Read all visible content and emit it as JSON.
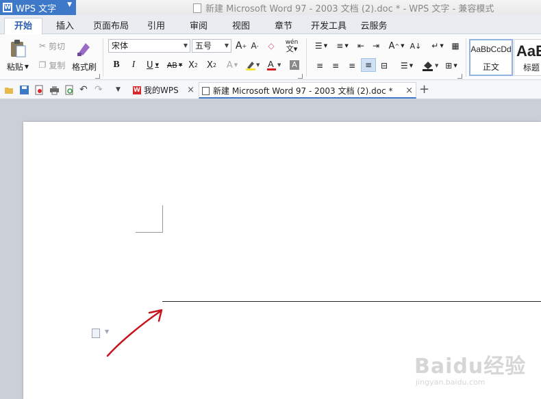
{
  "app": {
    "name": "WPS 文字",
    "window_title": "新建 Microsoft Word 97 - 2003 文档 (2).doc * - WPS 文字 - 兼容模式"
  },
  "tabs": [
    "开始",
    "插入",
    "页面布局",
    "引用",
    "审阅",
    "视图",
    "章节",
    "开发工具",
    "云服务"
  ],
  "clipboard": {
    "paste": "粘贴",
    "cut": "剪切",
    "copy": "复制",
    "format_painter": "格式刷"
  },
  "font": {
    "family": "宋体",
    "size": "五号"
  },
  "styles": [
    {
      "sample": "AaBbCcDd",
      "label": "正文"
    },
    {
      "sample": "AaE",
      "label": "标题"
    }
  ],
  "doc_tabs": [
    {
      "label": "我的WPS"
    },
    {
      "label": "新建 Microsoft Word 97 - 2003 文档 (2).doc *"
    }
  ],
  "watermark": {
    "brand": "Baidu经验",
    "url": "jingyan.baidu.com"
  },
  "colors": {
    "accent": "#3d78c9",
    "arrow": "#c8141e",
    "wps_red": "#d9262c"
  }
}
